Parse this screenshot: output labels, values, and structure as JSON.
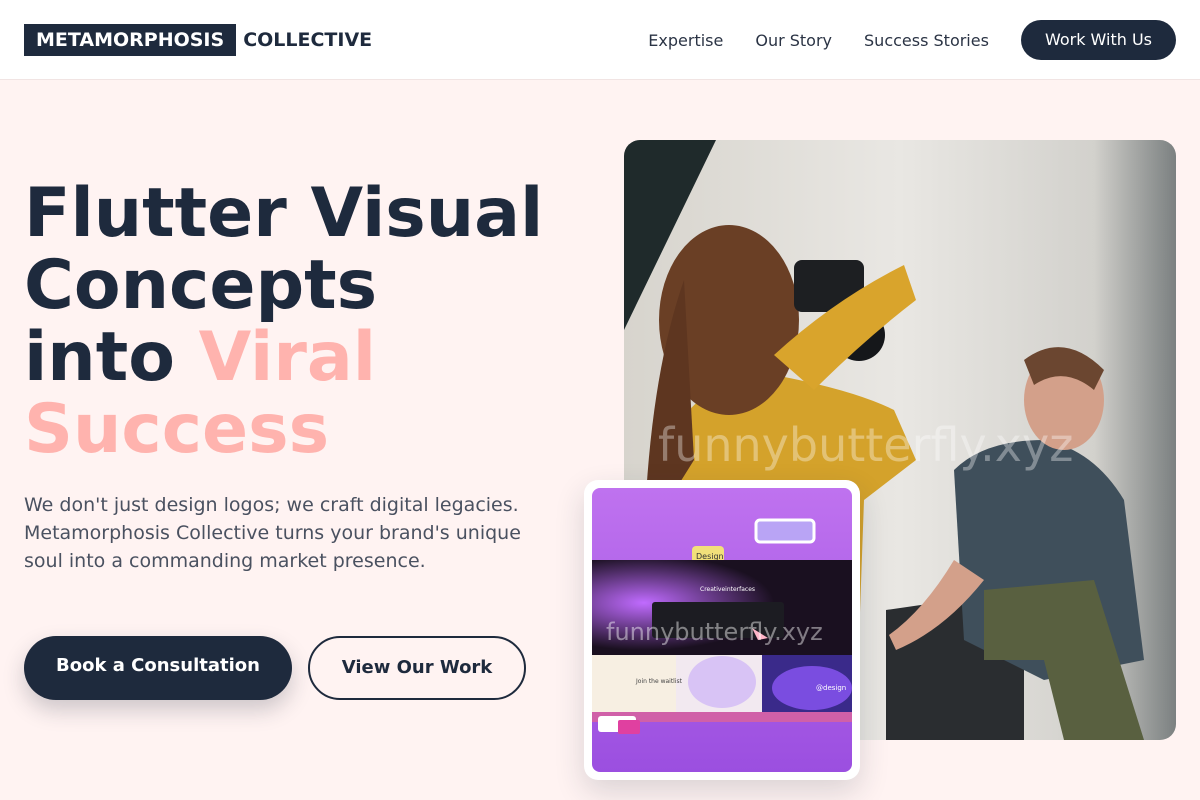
{
  "nav": {
    "logo_box": "METAMORPHOSIS",
    "logo_rest": "COLLECTIVE",
    "links": [
      "Expertise",
      "Our Story",
      "Success Stories"
    ],
    "cta": "Work With Us"
  },
  "hero": {
    "title_line1": "Flutter Visual",
    "title_line2": "Concepts",
    "title_line3_plain": "into ",
    "title_line3_accent": "Viral",
    "title_line4_accent": "Success",
    "description": "We don't just design logos; we craft digital legacies. Metamorphosis Collective turns your brand's unique soul into a commanding market presence.",
    "primary_button": "Book a Consultation",
    "secondary_button": "View Our Work"
  },
  "media": {
    "watermark": "funnybutterfly.xyz",
    "card_watermark": "funnybutterfly.xyz",
    "card_tag_design": "Design",
    "card_brand": "Creativeinterfaces",
    "card_join": "Join the waitlist",
    "card_tag_handle": "@design"
  },
  "colors": {
    "primary": "#1e2a3d",
    "accent": "#ffb3ae",
    "background": "#fff3f2"
  }
}
